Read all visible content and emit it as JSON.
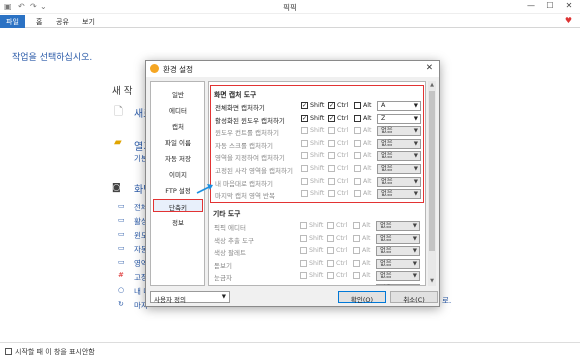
{
  "app": {
    "title": "픽픽",
    "tabs": [
      "파일",
      "홈",
      "공유",
      "보기"
    ],
    "prompt": "작업을 선택하십시오.",
    "bg": {
      "heading": "새 작",
      "new_label": "새로",
      "open_label": "열기",
      "open_sub": "기본",
      "capture_label": "화면",
      "items": [
        "전체",
        "활성",
        "윈도",
        "자동",
        "영역",
        "고정",
        "내 마",
        "마지"
      ],
      "right_tail": "로."
    },
    "status": {
      "checkbox_label": "시작할 때 이 창을 표시안함"
    }
  },
  "dialog": {
    "title": "환경 설정",
    "close": "✕",
    "nav": [
      "일반",
      "에디터",
      "캡처",
      "파일 이름",
      "자동 저장",
      "이미지",
      "FTP 설정",
      "단축키",
      "정보"
    ],
    "nav_selected": "단축키",
    "section1_title": "화면 캡처 도구",
    "section1_rows": [
      {
        "name": "전체화면 캡처하기",
        "shift": true,
        "ctrl": true,
        "alt": false,
        "key": "A",
        "enabled": true
      },
      {
        "name": "활성화된 윈도우 캡처하기",
        "shift": true,
        "ctrl": true,
        "alt": false,
        "key": "Z",
        "enabled": true
      },
      {
        "name": "윈도우 컨트롤 캡처하기",
        "shift": false,
        "ctrl": false,
        "alt": false,
        "key": "없음",
        "enabled": false
      },
      {
        "name": "자동 스크롤 캡처하기",
        "shift": false,
        "ctrl": false,
        "alt": false,
        "key": "없음",
        "enabled": false
      },
      {
        "name": "영역을 지정하여 캡처하기",
        "shift": false,
        "ctrl": false,
        "alt": false,
        "key": "없음",
        "enabled": false
      },
      {
        "name": "고정된 사각 영역을 캡처하기",
        "shift": false,
        "ctrl": false,
        "alt": false,
        "key": "없음",
        "enabled": false
      },
      {
        "name": "내 마음대로 캡처하기",
        "shift": false,
        "ctrl": false,
        "alt": false,
        "key": "없음",
        "enabled": false
      },
      {
        "name": "마지막 캡처 영역 반복",
        "shift": false,
        "ctrl": false,
        "alt": false,
        "key": "없음",
        "enabled": false
      }
    ],
    "section2_title": "기타 도구",
    "section2_rows": [
      {
        "name": "픽픽 에디터",
        "key": "없음"
      },
      {
        "name": "색상 추출 도구",
        "key": "없음"
      },
      {
        "name": "색상 팔레트",
        "key": "없음"
      },
      {
        "name": "돋보기",
        "key": "없음"
      },
      {
        "name": "눈금자",
        "key": "없음"
      },
      {
        "name": "각도기",
        "key": "없음"
      }
    ],
    "modifiers": {
      "shift": "Shift",
      "ctrl": "Ctrl",
      "alt": "Alt"
    },
    "preset": "사용자 정의",
    "ok": "확인(O)",
    "cancel": "취소(C)"
  }
}
